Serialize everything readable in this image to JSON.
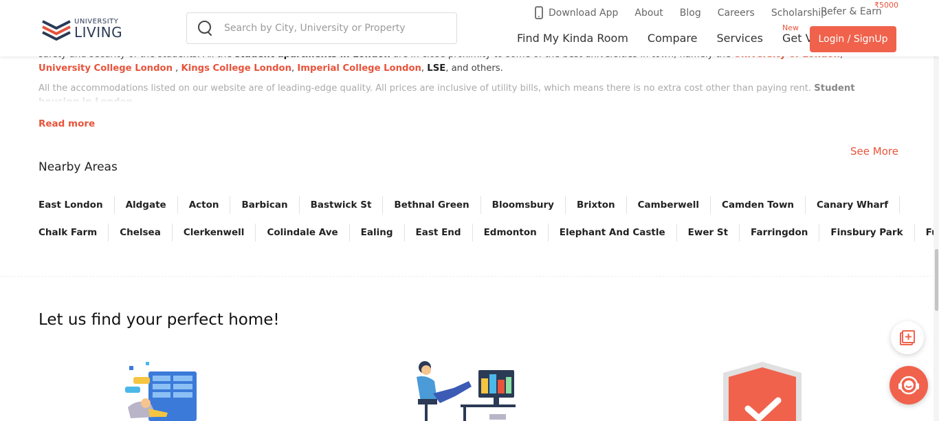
{
  "header": {
    "logo_small": "UNIVERSITY",
    "logo_big": "LIVING",
    "search_placeholder": "Search by City, University or Property",
    "top_links": [
      "Download App",
      "About",
      "Blog",
      "Careers",
      "Scholarship"
    ],
    "refer_label": "Refer & Earn",
    "refer_badge": "₹5000",
    "main_nav": [
      "Find My Kinda Room",
      "Compare",
      "Services",
      "Get Visa"
    ],
    "new_badge": "New",
    "login_label": "Login / SignUp"
  },
  "content": {
    "para1_intro": "safety and security of the students. All the ",
    "para1_bold": "student apartments in London",
    "para1_mid": " are in close proximity to some of the best universities in town, namely the ",
    "uni_links": [
      "University of London",
      "University College London",
      "Kings College London",
      "Imperial College London"
    ],
    "lse": "LSE",
    "para1_end": ", and others.",
    "para2_start": "All the accommodations listed on our website are of leading-edge quality. All prices are inclusive of utility bills, which means there is no extra cost other than paying rent. ",
    "para2_bold": "Student housing in London",
    "read_more": "Read more",
    "see_more": "See More"
  },
  "nearby": {
    "title": "Nearby Areas",
    "row1": [
      "East London",
      "Aldgate",
      "Acton",
      "Barbican",
      "Bastwick St",
      "Bethnal Green",
      "Bloomsbury",
      "Brixton",
      "Camberwell",
      "Camden Town",
      "Canary Wharf"
    ],
    "row2": [
      "Chalk Farm",
      "Chelsea",
      "Clerkenwell",
      "Colindale Ave",
      "Ealing",
      "East End",
      "Edmonton",
      "Elephant And Castle",
      "Ewer St",
      "Farringdon",
      "Finsbury Park",
      "Fulham"
    ]
  },
  "section": {
    "title": "Let us find your perfect home!"
  },
  "colors": {
    "accent": "#f0624c",
    "link": "#e8533b",
    "text_dark": "#222222",
    "navy": "#2b3a55"
  },
  "icons": {
    "search": "search-icon",
    "phone": "phone-icon",
    "add_compare": "add-icon",
    "chat": "chat-support-icon"
  }
}
